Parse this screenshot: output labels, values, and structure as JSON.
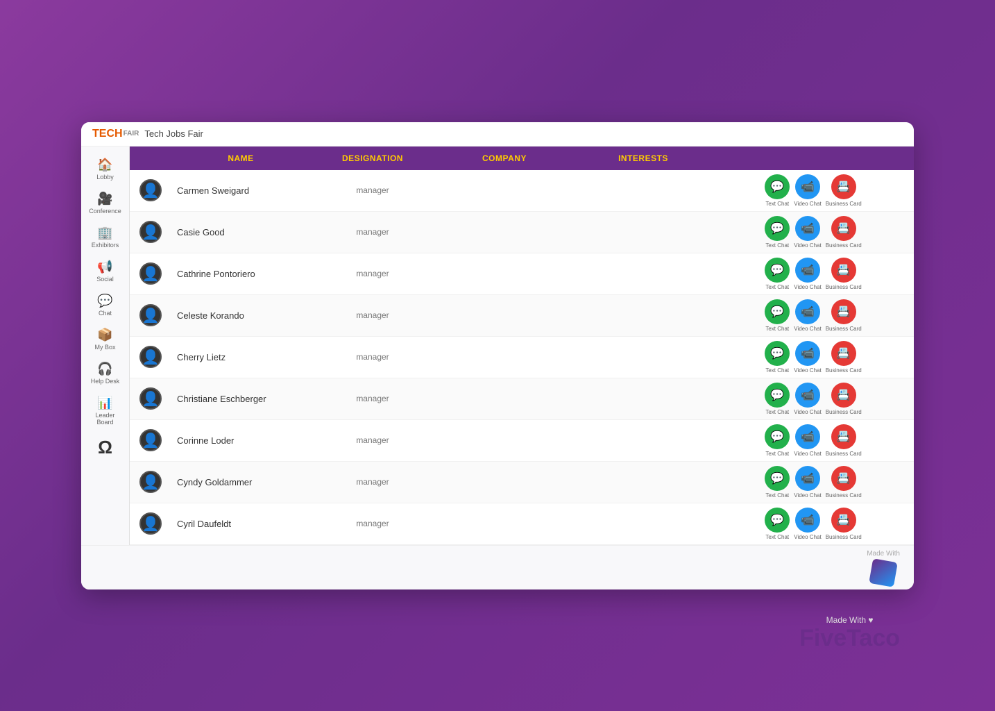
{
  "app": {
    "logo_tech": "TECH",
    "logo_fair": "FAIR",
    "logo_subtitle": "Tech Jobs Fair"
  },
  "sidebar": {
    "items": [
      {
        "id": "lobby",
        "icon": "🏠",
        "label": "Lobby"
      },
      {
        "id": "conference",
        "icon": "🎥",
        "label": "Conference"
      },
      {
        "id": "exhibitors",
        "icon": "🏢",
        "label": "Exhibitors"
      },
      {
        "id": "social",
        "icon": "📢",
        "label": "Social"
      },
      {
        "id": "chat",
        "icon": "💬",
        "label": "Chat"
      },
      {
        "id": "my-box",
        "icon": "📦",
        "label": "My Box"
      },
      {
        "id": "help-desk",
        "icon": "🎧",
        "label": "Help Desk"
      },
      {
        "id": "leader-board",
        "icon": "📊",
        "label": "Leader Board"
      },
      {
        "id": "profile",
        "icon": "Ω",
        "label": ""
      }
    ]
  },
  "table": {
    "columns": [
      {
        "id": "avatar",
        "label": ""
      },
      {
        "id": "name",
        "label": "NAME"
      },
      {
        "id": "designation",
        "label": "DESIGNATION"
      },
      {
        "id": "company",
        "label": "COMPANY"
      },
      {
        "id": "interests",
        "label": "INTERESTS"
      },
      {
        "id": "actions",
        "label": ""
      }
    ],
    "action_labels": {
      "text_chat": "Text Chat",
      "video_chat": "Video Chat",
      "business_card": "Business Card"
    },
    "rows": [
      {
        "name": "Carmen Sweigard",
        "designation": "manager",
        "company": "",
        "interests": ""
      },
      {
        "name": "Casie Good",
        "designation": "manager",
        "company": "",
        "interests": ""
      },
      {
        "name": "Cathrine Pontoriero",
        "designation": "manager",
        "company": "",
        "interests": ""
      },
      {
        "name": "Celeste Korando",
        "designation": "manager",
        "company": "",
        "interests": ""
      },
      {
        "name": "Cherry Lietz",
        "designation": "manager",
        "company": "",
        "interests": ""
      },
      {
        "name": "Christiane Eschberger",
        "designation": "manager",
        "company": "",
        "interests": ""
      },
      {
        "name": "Corinne Loder",
        "designation": "manager",
        "company": "",
        "interests": ""
      },
      {
        "name": "Cyndy Goldammer",
        "designation": "manager",
        "company": "",
        "interests": ""
      },
      {
        "name": "Cyril Daufeldt",
        "designation": "manager",
        "company": "",
        "interests": ""
      }
    ]
  },
  "footer": {
    "made_with": "Made With",
    "brand_name": "FiveTaco"
  }
}
